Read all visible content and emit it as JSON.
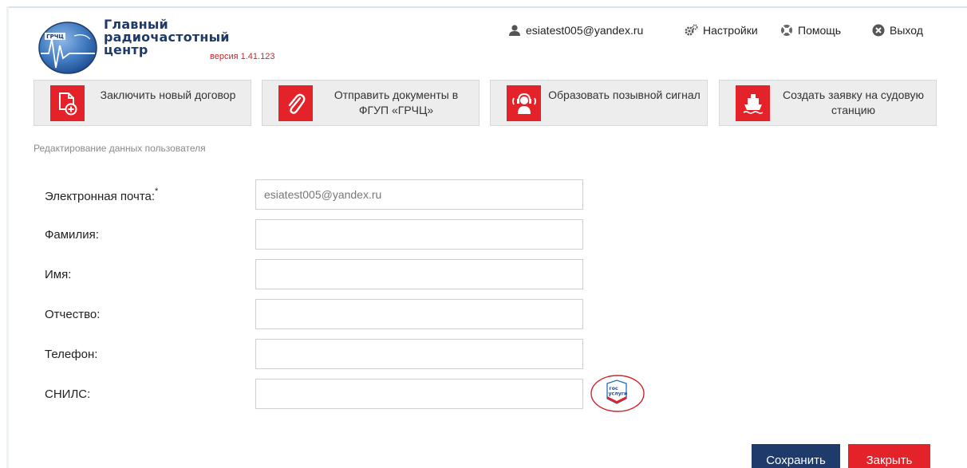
{
  "header": {
    "logo_text": "ГРЧЦ",
    "title_lines": [
      "Главный",
      "радиочастотный",
      "центр"
    ],
    "version": "версия 1.41.123",
    "user_email": "esiatest005@yandex.ru",
    "settings_label": "Настройки",
    "help_label": "Помощь",
    "logout_label": "Выход"
  },
  "actions": [
    {
      "label": "Заключить новый договор",
      "icon": "new-contract-icon"
    },
    {
      "label": "Отправить документы в ФГУП «ГРЧЦ»",
      "icon": "paperclip-icon"
    },
    {
      "label": "Образовать позывной сигнал",
      "icon": "radio-operator-icon"
    },
    {
      "label": "Создать заявку на судовую станцию",
      "icon": "ship-icon"
    }
  ],
  "page_heading": "Редактирование данных пользователя",
  "form": {
    "email": {
      "label": "Электронная почта:",
      "required_mark": "*",
      "value": "esiatest005@yandex.ru"
    },
    "last_name": {
      "label": "Фамилия:",
      "value": ""
    },
    "first_name": {
      "label": "Имя:",
      "value": ""
    },
    "middle_name": {
      "label": "Отчество:",
      "value": ""
    },
    "phone": {
      "label": "Телефон:",
      "value": ""
    },
    "snils": {
      "label": "СНИЛС:",
      "value": ""
    },
    "gosuslugi_logo_text": "гос услуги"
  },
  "buttons": {
    "save": "Сохранить",
    "close": "Закрыть"
  },
  "colors": {
    "brand_red": "#e4222a",
    "brand_navy": "#1e3b6c"
  }
}
